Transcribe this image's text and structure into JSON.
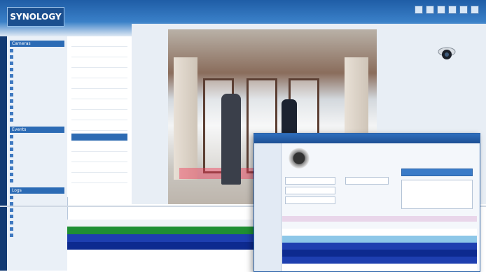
{
  "header": {
    "logo": "SYNOLOGY"
  },
  "sidebar": {
    "sections": [
      {
        "title": "Cameras",
        "items": [
          "",
          "",
          "",
          "",
          "",
          "",
          "",
          "",
          "",
          "",
          "",
          ""
        ]
      },
      {
        "title": "Events",
        "items": [
          "",
          "",
          "",
          "",
          "",
          "",
          "",
          ""
        ]
      },
      {
        "title": "Logs",
        "items": [
          "",
          "",
          "",
          "",
          "",
          "",
          ""
        ]
      }
    ]
  },
  "nav": {
    "items": [
      "",
      "",
      "",
      "",
      "",
      "",
      "",
      "",
      "",
      "",
      "",
      "",
      "",
      ""
    ],
    "selected_index": 9
  },
  "table": {
    "headers": [
      "",
      "",
      "",
      ""
    ],
    "rows": [
      {
        "color": "green",
        "cells": [
          "",
          "",
          "",
          ""
        ]
      },
      {
        "color": "blue",
        "cells": [
          "",
          "",
          "",
          ""
        ]
      },
      {
        "color": "dark",
        "cells": [
          "",
          "",
          "",
          ""
        ]
      }
    ]
  },
  "popup": {
    "title": ""
  },
  "colors": {
    "header_blue": "#1f5da6",
    "selected_nav": "#2d6bb3",
    "row_green": "#1f8f33",
    "row_blue": "#1e3fb0",
    "row_dark": "#0d2a8f"
  }
}
